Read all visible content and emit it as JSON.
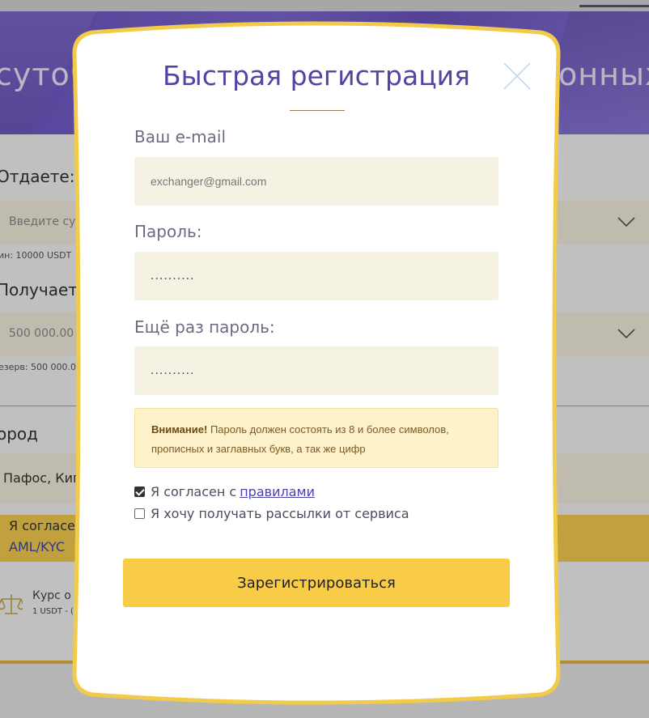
{
  "background": {
    "banner_text_left": "суточ",
    "banner_text_right": "онных",
    "give_label": "Отдаете:",
    "give_placeholder": "Введите сум",
    "give_min": "ин: 10000 USDT",
    "receive_label": "Получаете",
    "receive_value": "500 000.00",
    "receive_reserve": "езерв: 500 000.0",
    "city_label": "ород",
    "city_value": "Пафос, Кип",
    "agree_text": "Я согласе",
    "agree_link": "AML/KYC",
    "rate_title": "Курс о",
    "rate_sub": "1 USDT - (",
    "colors": {
      "banner": "#7460cc",
      "field": "#f5f0df",
      "agree_bar": "#f7cf50"
    }
  },
  "modal": {
    "title": "Быстрая регистрация",
    "close_icon": "close-icon",
    "email": {
      "label": "Ваш e-mail",
      "placeholder": "exchanger@gmail.com"
    },
    "password": {
      "label": "Пароль:",
      "value": ".........."
    },
    "password_repeat": {
      "label": "Ещё раз пароль:",
      "value": ".........."
    },
    "alert": {
      "strong": "Внимание!",
      "text": "Пароль должен состоять из 8 и более символов, прописных и заглавных букв, а так же цифр"
    },
    "agree_rules": {
      "label": "Я согласен с",
      "link": "правилами",
      "checked": true
    },
    "newsletter": {
      "label": "Я хочу получать рассылки от сервиса",
      "checked": false
    },
    "submit_label": "Зарегистрироваться",
    "colors": {
      "title": "#5145a1",
      "border": "#f3cb4a",
      "button": "#f8cc46",
      "alert_bg": "#fdf2c9",
      "input_bg": "#f5f1e3"
    }
  }
}
